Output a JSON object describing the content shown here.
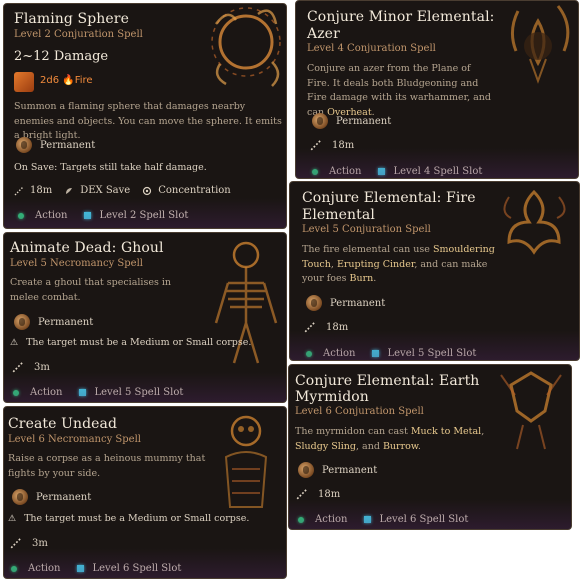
{
  "colors": {
    "card_bg": "#1a1513",
    "title": "#f2e9da",
    "subtitle": "#c0956b",
    "description": "#b5a590",
    "highlight": "#e8c98e",
    "action_dot": "#2bd07d",
    "spell_slot": "#3fd4ee",
    "fire": "#f08a3c"
  },
  "cards": [
    {
      "title": "Flaming Sphere",
      "subtitle": "Level 2 Conjuration Spell",
      "damage": "2~12 Damage",
      "dice": "2d6",
      "element": "Fire",
      "description": "Summon a flaming sphere that damages nearby enemies and objects. You can move the sphere. It emits a bright light.",
      "duration": "Permanent",
      "on_save": "On Save: Targets still take half damage.",
      "range": "18m",
      "save": "DEX Save",
      "concentration": "Concentration",
      "action": "Action",
      "slot": "Level 2 Spell Slot",
      "icon": "fire-sphere-icon"
    },
    {
      "title": "Conjure Minor Elemental:",
      "title2": "Azer",
      "subtitle": "Level 4 Conjuration Spell",
      "desc_parts": [
        "Conjure an azer from the Plane of Fire. It deals both Bludgeoning and Fire damage with its warhammer, and can ",
        "Overheat",
        "."
      ],
      "duration": "Permanent",
      "range": "18m",
      "action": "Action",
      "slot": "Level 4 Spell Slot",
      "icon": "azer-icon"
    },
    {
      "title": "Conjure Elemental: Fire",
      "title2": "Elemental",
      "subtitle": "Level 5 Conjuration Spell",
      "desc_parts": [
        "The fire elemental can use ",
        "Smouldering Touch",
        ", ",
        "Erupting Cinder",
        ", and can make your foes ",
        "Burn",
        "."
      ],
      "duration": "Permanent",
      "range": "18m",
      "action": "Action",
      "slot": "Level 5 Spell Slot",
      "icon": "fire-elemental-icon"
    },
    {
      "title": "Animate Dead: Ghoul",
      "subtitle": "Level 5 Necromancy Spell",
      "description": "Create a ghoul that specialises in melee combat.",
      "duration": "Permanent",
      "warning": "The target must be a Medium or Small corpse.",
      "range": "3m",
      "action": "Action",
      "slot": "Level 5 Spell Slot",
      "icon": "skeleton-icon"
    },
    {
      "title": "Conjure Elemental: Earth",
      "title2": "Myrmidon",
      "subtitle": "Level 6 Conjuration Spell",
      "desc_parts": [
        "The myrmidon can cast ",
        "Muck to Metal",
        ", ",
        "Sludgy Sling",
        ", and ",
        "Burrow",
        "."
      ],
      "duration": "Permanent",
      "range": "18m",
      "action": "Action",
      "slot": "Level 6 Spell Slot",
      "icon": "earth-myrmidon-icon"
    },
    {
      "title": "Create Undead",
      "subtitle": "Level 6 Necromancy Spell",
      "description": "Raise a corpse as a heinous mummy that fights by your side.",
      "duration": "Permanent",
      "warning": "The target must be a Medium or Small corpse.",
      "range": "3m",
      "action": "Action",
      "slot": "Level 6 Spell Slot",
      "icon": "undead-skull-icon"
    }
  ]
}
